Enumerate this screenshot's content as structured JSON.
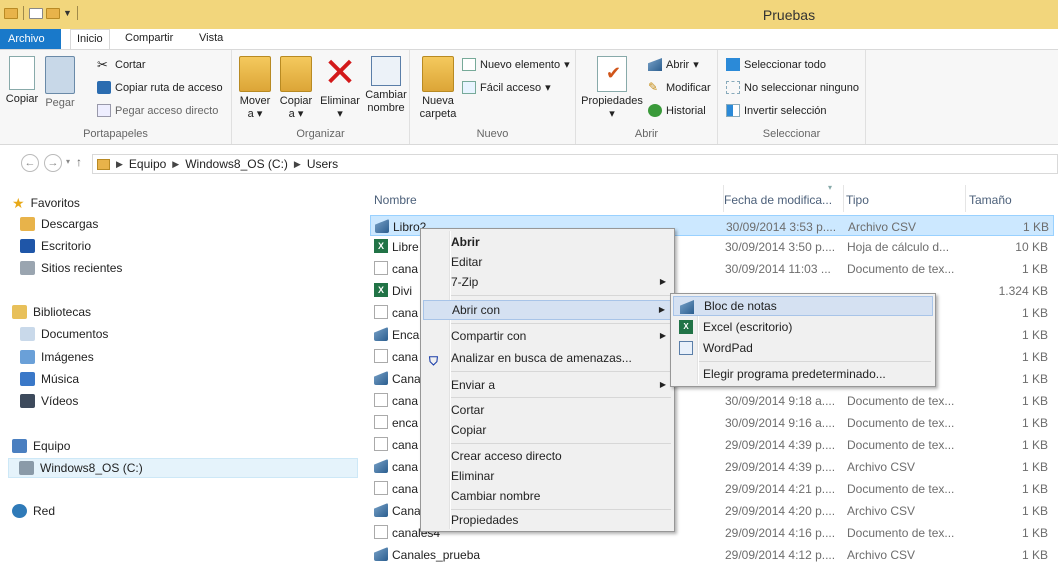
{
  "window": {
    "title": "Pruebas"
  },
  "ribbon_tabs": [
    "Archivo",
    "Inicio",
    "Compartir",
    "Vista"
  ],
  "ribbon": {
    "portapapeles": {
      "label": "Portapapeles",
      "copiar": "Copiar",
      "pegar": "Pegar",
      "cortar": "Cortar",
      "copiar_ruta": "Copiar ruta de acceso",
      "pegar_acceso": "Pegar acceso directo"
    },
    "organizar": {
      "label": "Organizar",
      "mover_a": "Mover a",
      "copiar_a": "Copiar a",
      "eliminar": "Eliminar",
      "cambiar_nombre": "Cambiar nombre"
    },
    "nuevo": {
      "label": "Nuevo",
      "nueva_carpeta": "Nueva carpeta",
      "nuevo_elemento": "Nuevo elemento",
      "facil_acceso": "Fácil acceso"
    },
    "abrir": {
      "label": "Abrir",
      "propiedades": "Propiedades",
      "abrir": "Abrir",
      "modificar": "Modificar",
      "historial": "Historial"
    },
    "seleccionar": {
      "label": "Seleccionar",
      "todo": "Seleccionar todo",
      "ninguno": "No seleccionar ninguno",
      "invertir": "Invertir selección"
    }
  },
  "address": {
    "crumbs": [
      "Equipo",
      "Windows8_OS (C:)",
      "Users"
    ]
  },
  "nav": {
    "favoritos": "Favoritos",
    "descargas": "Descargas",
    "escritorio": "Escritorio",
    "sitios": "Sitios recientes",
    "bibliotecas": "Bibliotecas",
    "documentos": "Documentos",
    "imagenes": "Imágenes",
    "musica": "Música",
    "videos": "Vídeos",
    "equipo": "Equipo",
    "windows_os": "Windows8_OS (C:)",
    "red": "Red"
  },
  "columns": {
    "nombre": "Nombre",
    "fecha": "Fecha de modifica...",
    "tipo": "Tipo",
    "tamano": "Tamaño"
  },
  "files": [
    {
      "name": "Libro2",
      "date": "30/09/2014 3:53 p....",
      "type": "Archivo CSV",
      "size": "1 KB",
      "icon": "csv"
    },
    {
      "name": "Libre",
      "date": "30/09/2014 3:50 p....",
      "type": "Hoja de cálculo d...",
      "size": "10 KB",
      "icon": "xls"
    },
    {
      "name": "cana",
      "date": "30/09/2014 11:03 ...",
      "type": "Documento de tex...",
      "size": "1 KB",
      "icon": "txt"
    },
    {
      "name": "Divi",
      "date": "",
      "type": "",
      "size": "1.324 KB",
      "icon": "xls"
    },
    {
      "name": "cana",
      "date": "",
      "type": "",
      "size": "1 KB",
      "icon": "txt"
    },
    {
      "name": "Enca",
      "date": "",
      "type": "",
      "size": "1 KB",
      "icon": "csv"
    },
    {
      "name": "cana",
      "date": "",
      "type": "",
      "size": "1 KB",
      "icon": "txt"
    },
    {
      "name": "Cana",
      "date": "",
      "type": "",
      "size": "1 KB",
      "icon": "csv"
    },
    {
      "name": "cana",
      "date": "30/09/2014 9:18 a....",
      "type": "Documento de tex...",
      "size": "1 KB",
      "icon": "txt"
    },
    {
      "name": "enca",
      "date": "30/09/2014 9:16 a....",
      "type": "Documento de tex...",
      "size": "1 KB",
      "icon": "txt"
    },
    {
      "name": "cana",
      "date": "29/09/2014 4:39 p....",
      "type": "Documento de tex...",
      "size": "1 KB",
      "icon": "txt"
    },
    {
      "name": "cana",
      "date": "29/09/2014 4:39 p....",
      "type": "Archivo CSV",
      "size": "1 KB",
      "icon": "csv"
    },
    {
      "name": "cana",
      "date": "29/09/2014 4:21 p....",
      "type": "Documento de tex...",
      "size": "1 KB",
      "icon": "txt"
    },
    {
      "name": "Cana",
      "date": "29/09/2014 4:20 p....",
      "type": "Archivo CSV",
      "size": "1 KB",
      "icon": "csv"
    },
    {
      "name": "canales4",
      "date": "29/09/2014 4:16 p....",
      "type": "Documento de tex...",
      "size": "1 KB",
      "icon": "txt"
    },
    {
      "name": "Canales_prueba",
      "date": "29/09/2014 4:12 p....",
      "type": "Archivo CSV",
      "size": "1 KB",
      "icon": "csv"
    }
  ],
  "context_menu": {
    "abrir": "Abrir",
    "editar": "Editar",
    "zip": "7-Zip",
    "abrir_con": "Abrir con",
    "compartir_con": "Compartir con",
    "analizar": "Analizar en busca de amenazas...",
    "enviar_a": "Enviar a",
    "cortar": "Cortar",
    "copiar": "Copiar",
    "crear_acceso": "Crear acceso directo",
    "eliminar": "Eliminar",
    "cambiar_nombre": "Cambiar nombre",
    "propiedades": "Propiedades"
  },
  "submenu": {
    "bloc": "Bloc de notas",
    "excel": "Excel (escritorio)",
    "wordpad": "WordPad",
    "elegir": "Elegir programa predeterminado..."
  },
  "colors": {
    "accent": "#1979ca",
    "titlebar": "#f2d67c",
    "selection": "#cce8ff"
  }
}
